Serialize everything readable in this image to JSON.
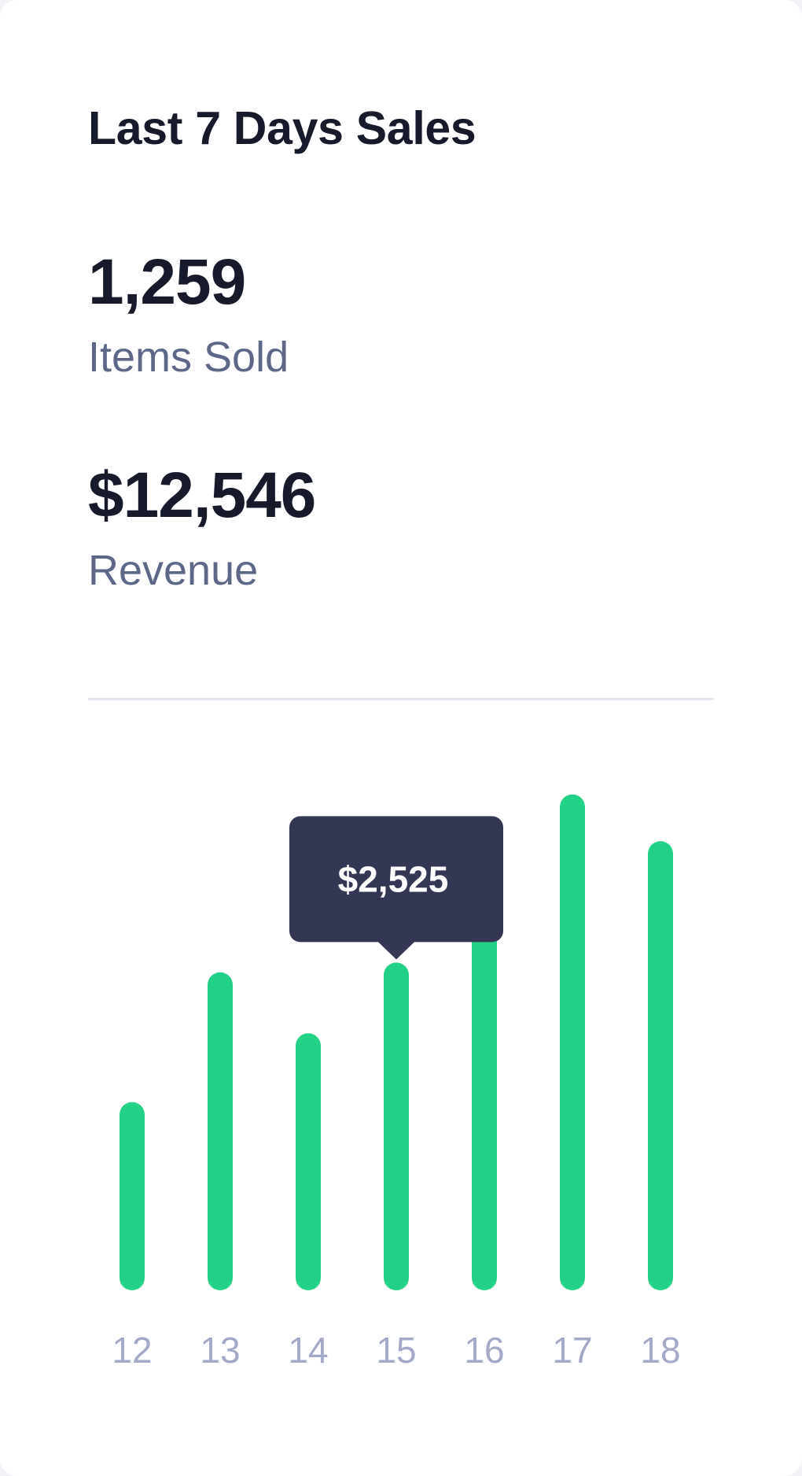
{
  "card": {
    "title": "Last 7 Days Sales"
  },
  "stats": {
    "items_sold_value": "1,259",
    "items_sold_label": "Items Sold",
    "revenue_value": "$12,546",
    "revenue_label": "Revenue"
  },
  "colors": {
    "bar": "#22d185",
    "tooltip_bg": "#343754",
    "tick_label": "#a3a9c6",
    "divider": "#e4e6f0"
  },
  "chart_data": {
    "type": "bar",
    "categories": [
      "12",
      "13",
      "14",
      "15",
      "16",
      "17",
      "18"
    ],
    "values": [
      1450,
      2450,
      1980,
      2525,
      3520,
      3820,
      3460
    ],
    "ylim": [
      0,
      4000
    ],
    "grid": false,
    "tooltip": {
      "category": "15",
      "text": "$2,525"
    }
  }
}
